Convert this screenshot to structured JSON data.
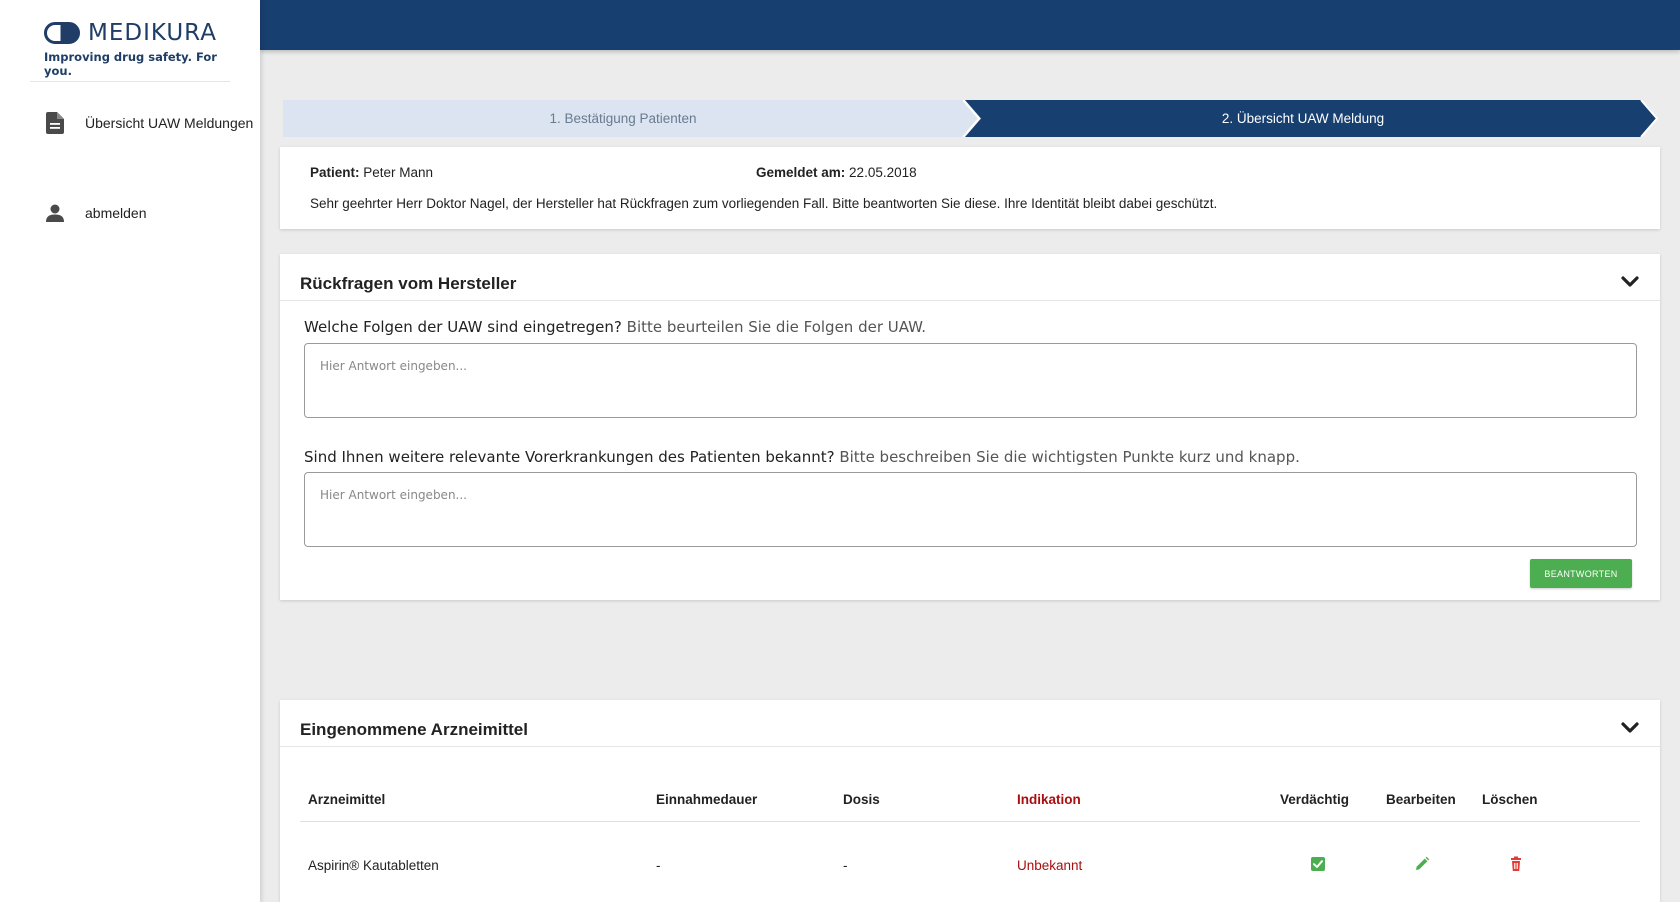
{
  "brand": {
    "name": "MEDIKURA",
    "tagline": "Improving drug safety. For you."
  },
  "sidebar": {
    "items": [
      {
        "label": "Übersicht UAW Meldungen",
        "icon": "document-icon"
      },
      {
        "label": "abmelden",
        "icon": "person-icon"
      }
    ]
  },
  "stepper": {
    "steps": [
      {
        "label": "1. Bestätigung Patienten",
        "active": false
      },
      {
        "label": "2. Übersicht UAW Meldung",
        "active": true
      }
    ]
  },
  "patient": {
    "name_label": "Patient:",
    "name_value": "Peter Mann",
    "date_label": "Gemeldet am:",
    "date_value": "22.05.2018",
    "notice": "Sehr geehrter Herr Doktor Nagel, der Hersteller hat Rückfragen zum vorliegenden Fall. Bitte beantworten Sie diese. Ihre Identität bleibt dabei geschützt."
  },
  "questions": {
    "title": "Rückfragen vom Hersteller",
    "items": [
      {
        "question": "Welche Folgen der UAW sind eingetregen?",
        "hint": "Bitte beurteilen Sie die Folgen der UAW.",
        "placeholder": "Hier Antwort eingeben...",
        "value": ""
      },
      {
        "question": "Sind Ihnen weitere relevante Vorerkrankungen des Patienten bekannt?",
        "hint": "Bitte beschreiben Sie die wichtigsten Punkte kurz und knapp.",
        "placeholder": "Hier Antwort eingeben...",
        "value": ""
      }
    ],
    "submit_label": "BEANTWORTEN"
  },
  "medications": {
    "title": "Eingenommene Arzneimittel",
    "columns": [
      "Arzneimittel",
      "Einnahmedauer",
      "Dosis",
      "Indikation",
      "Verdächtig",
      "Bearbeiten",
      "Löschen"
    ],
    "rows": [
      {
        "drug": "Aspirin® Kautabletten",
        "duration": "-",
        "dose": "-",
        "indication": "Unbekannt",
        "suspected": true
      }
    ]
  },
  "colors": {
    "primary": "#173f70",
    "step_inactive": "#dbe4f0",
    "accent_green": "#4cae50",
    "warning_red": "#a80e0e",
    "delete_red": "#e53935"
  }
}
